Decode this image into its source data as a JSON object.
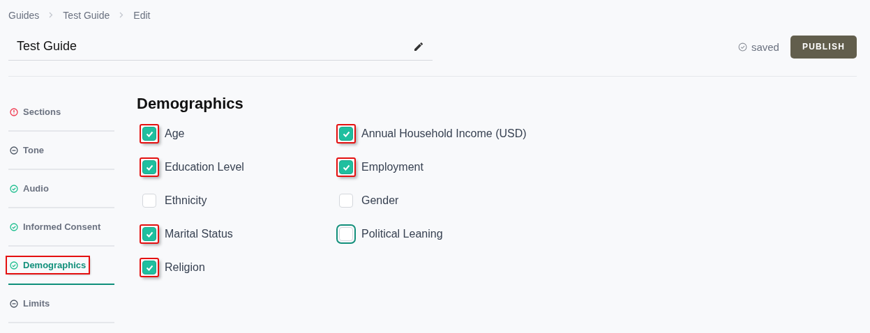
{
  "breadcrumbs": [
    "Guides",
    "Test Guide",
    "Edit"
  ],
  "title_field": {
    "value": "Test Guide"
  },
  "save_status": "saved",
  "publish_button": "PUBLISH",
  "sidebar": {
    "items": [
      {
        "label": "Sections",
        "kind": "error",
        "selected": false,
        "highlighted": false
      },
      {
        "label": "Tone",
        "kind": "pending",
        "selected": false,
        "highlighted": false
      },
      {
        "label": "Audio",
        "kind": "done",
        "selected": false,
        "highlighted": false
      },
      {
        "label": "Informed Consent",
        "kind": "done",
        "selected": false,
        "highlighted": false
      },
      {
        "label": "Demographics",
        "kind": "done",
        "selected": true,
        "highlighted": true
      },
      {
        "label": "Limits",
        "kind": "pending",
        "selected": false,
        "highlighted": false
      }
    ]
  },
  "section": {
    "heading": "Demographics",
    "options": [
      {
        "label": "Age",
        "checked": true,
        "highlighted": true,
        "focused": false
      },
      {
        "label": "Annual Household Income (USD)",
        "checked": true,
        "highlighted": true,
        "focused": false
      },
      {
        "label": "Education Level",
        "checked": true,
        "highlighted": true,
        "focused": false
      },
      {
        "label": "Employment",
        "checked": true,
        "highlighted": true,
        "focused": false
      },
      {
        "label": "Ethnicity",
        "checked": false,
        "highlighted": false,
        "focused": false
      },
      {
        "label": "Gender",
        "checked": false,
        "highlighted": false,
        "focused": false
      },
      {
        "label": "Marital Status",
        "checked": true,
        "highlighted": true,
        "focused": false
      },
      {
        "label": "Political Leaning",
        "checked": false,
        "highlighted": false,
        "focused": true
      },
      {
        "label": "Religion",
        "checked": true,
        "highlighted": true,
        "focused": false
      }
    ]
  }
}
